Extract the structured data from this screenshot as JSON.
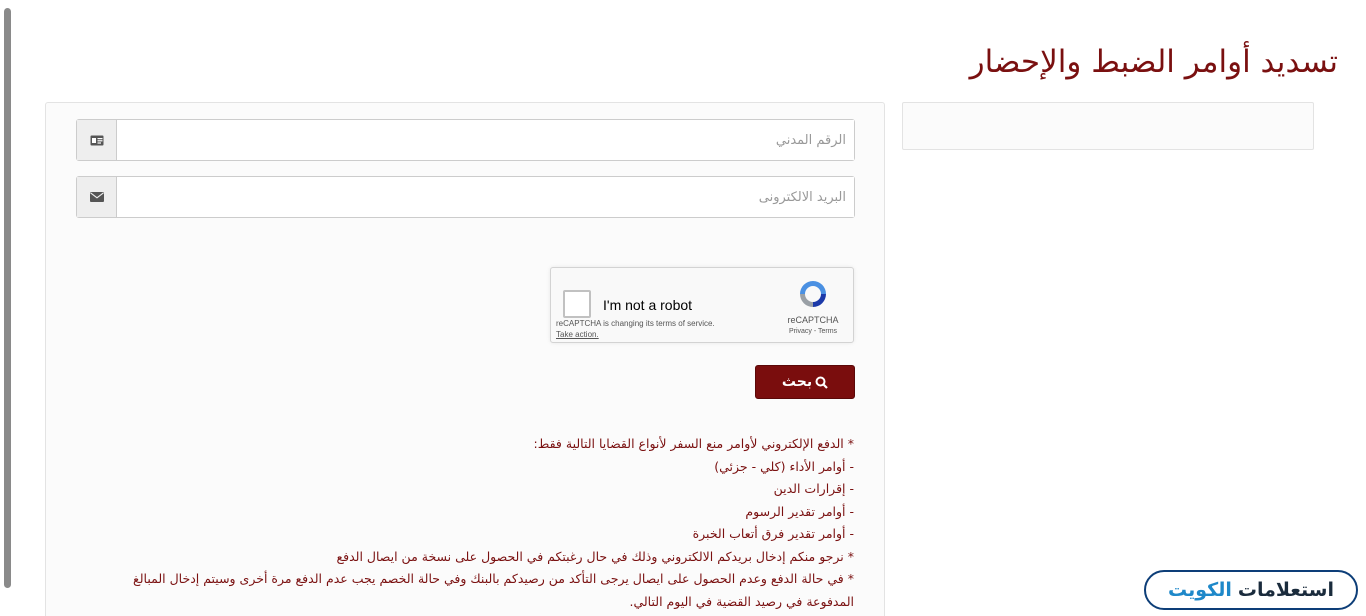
{
  "page": {
    "title": "تسديد أوامر الضبط والإحضار"
  },
  "form": {
    "civil_id": {
      "placeholder": "الرقم المدني",
      "value": "",
      "icon": "id-card-icon"
    },
    "email": {
      "placeholder": "البريد الالكترونى",
      "value": "",
      "icon": "envelope-icon"
    },
    "recaptcha": {
      "label": "I'm not a robot",
      "notice": "reCAPTCHA is changing its terms of service.",
      "take_action": "Take action.",
      "brand": "reCAPTCHA",
      "links": "Privacy - Terms"
    },
    "search_button": {
      "label": "بحث",
      "icon": "search-icon"
    }
  },
  "notes": [
    "* الدفع الإلكتروني لأوامر منع السفر لأنواع القضايا التالية فقط:",
    "- أوامر الأداء (كلي - جزئي)",
    "- إقرارات الدين",
    "- أوامر تقدير الرسوم",
    "- أوامر تقدير فرق أتعاب الخبرة",
    "* نرجو منكم إدخال بريدكم الالكتروني وذلك في حال رغبتكم في الحصول على نسخة من ايصال الدفع",
    "* في حالة الدفع وعدم الحصول على ايصال يرجى التأكد من رصيدكم بالبنك وفي حالة الخصم يجب عدم الدفع مرة أخرى وسيتم إدخال المبالغ",
    "المدفوعة في رصيد القضية في اليوم التالي."
  ],
  "watermark": {
    "word1": "استعلامات",
    "word2": "الكويت"
  },
  "colors": {
    "accent": "#7a0d0d",
    "title": "#7a1010",
    "logo_blue": "#1e88c9",
    "logo_border": "#0d3e78"
  }
}
